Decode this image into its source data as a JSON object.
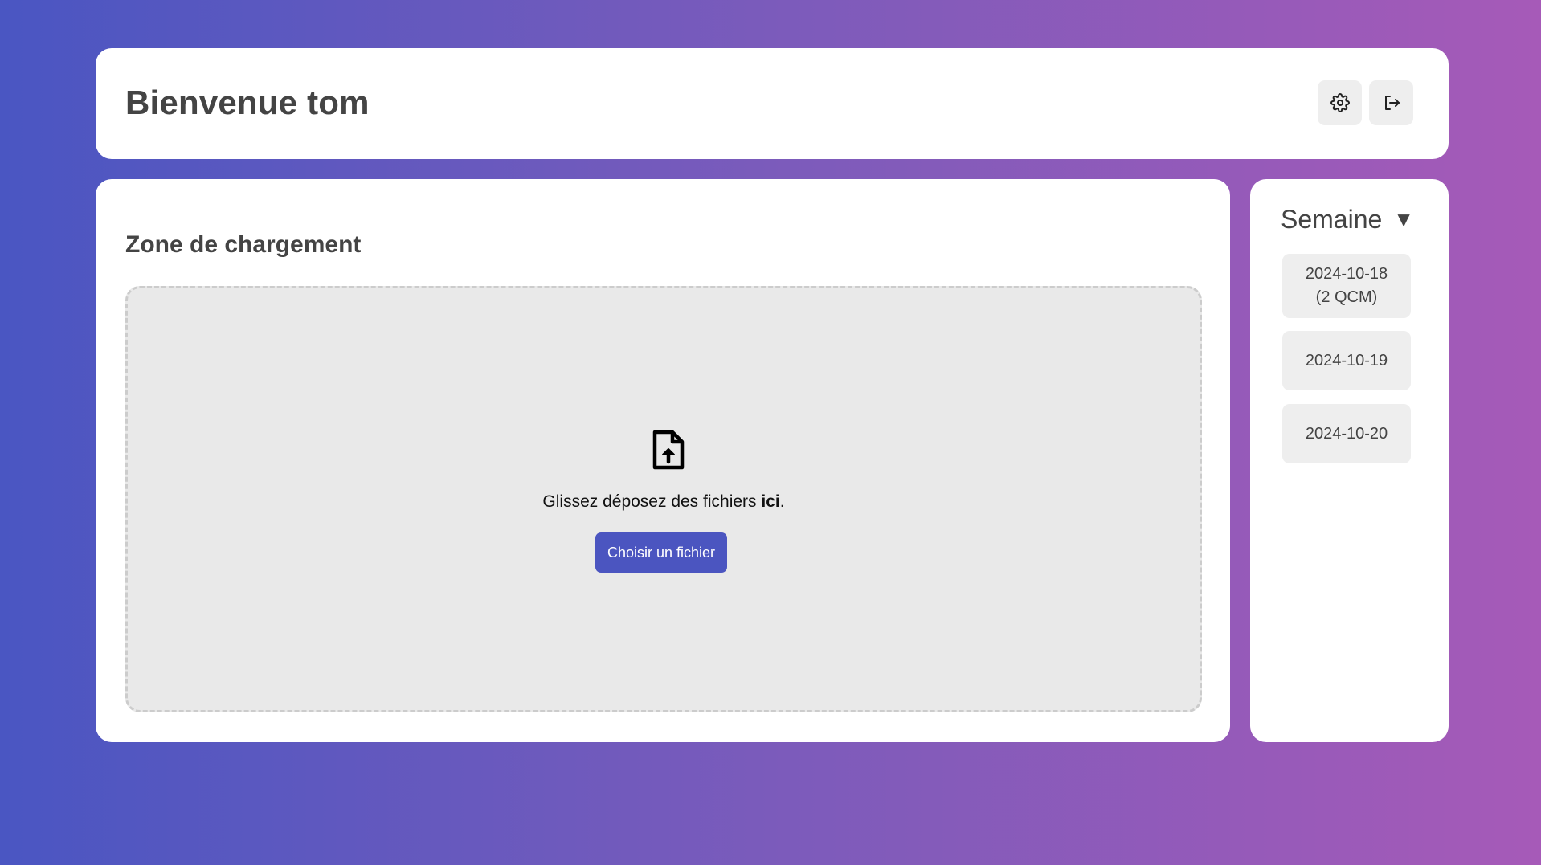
{
  "header": {
    "title": "Bienvenue tom",
    "settings_icon": "gear-icon",
    "logout_icon": "logout-icon"
  },
  "upload": {
    "section_title": "Zone de chargement",
    "icon": "file-upload-icon",
    "drop_text_prefix": "Glissez déposez des fichiers ",
    "drop_text_bold": "ici",
    "drop_text_suffix": ".",
    "choose_button": "Choisir un fichier"
  },
  "sidebar": {
    "title": "Semaine",
    "caret": "▼",
    "dates": [
      {
        "label": "2024-10-18\n(2 QCM)"
      },
      {
        "label": "2024-10-19"
      },
      {
        "label": "2024-10-20"
      }
    ]
  },
  "colors": {
    "accent": "#4b55c0",
    "gradient_start": "#4a56c2",
    "gradient_end": "#a65ab8"
  }
}
